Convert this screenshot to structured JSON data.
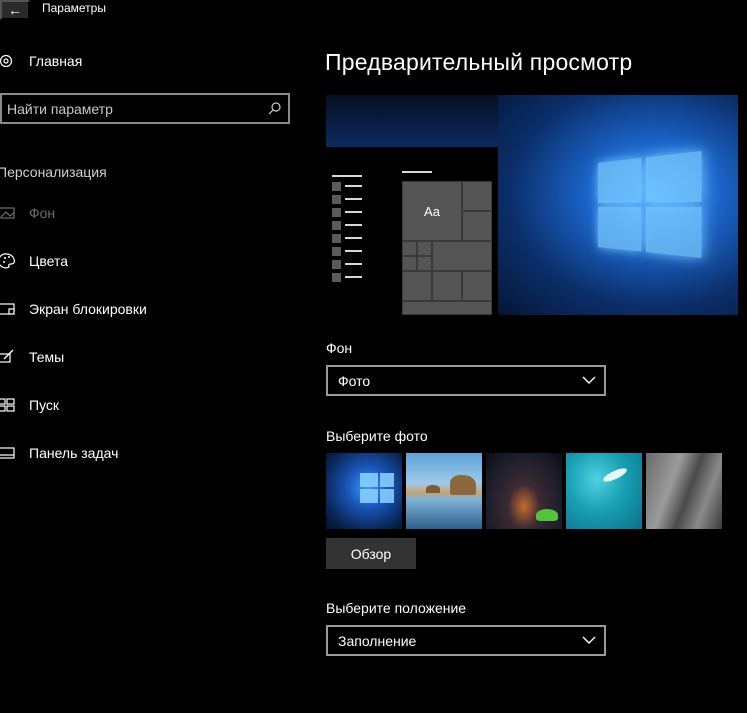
{
  "titlebar": {
    "back_glyph": "←",
    "title": "Параметры"
  },
  "sidebar": {
    "home_label": "Главная",
    "search_placeholder": "Найти параметр",
    "section_title": "Персонализация",
    "items": [
      {
        "label": "Фон",
        "icon": "picture-icon",
        "active": true
      },
      {
        "label": "Цвета",
        "icon": "palette-icon",
        "active": false
      },
      {
        "label": "Экран блокировки",
        "icon": "lock-screen-icon",
        "active": false
      },
      {
        "label": "Темы",
        "icon": "brush-icon",
        "active": false
      },
      {
        "label": "Пуск",
        "icon": "start-icon",
        "active": false
      },
      {
        "label": "Панель задач",
        "icon": "taskbar-icon",
        "active": false
      }
    ]
  },
  "main": {
    "page_title": "Предварительный просмотр",
    "preview_tile_text": "Aa",
    "background_label": "Фон",
    "background_value": "Фото",
    "choose_photo_label": "Выберите фото",
    "photos": [
      "windows-hero-wallpaper",
      "coast-rocks-photo",
      "milky-way-night-photo",
      "underwater-swimmer-photo",
      "rock-cliff-photo"
    ],
    "browse_label": "Обзор",
    "position_label": "Выберите положение",
    "position_value": "Заполнение"
  },
  "colors": {
    "background": "#000000",
    "control_border": "#9a9a9a",
    "button_bg": "#333333",
    "inactive_text": "#6e6e6e"
  }
}
